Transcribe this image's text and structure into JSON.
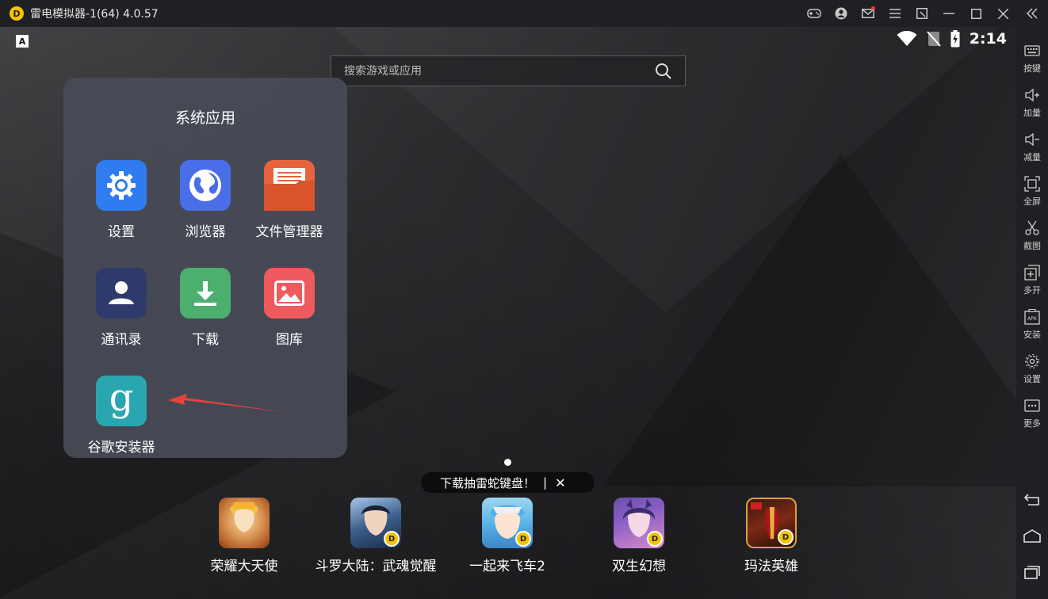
{
  "window": {
    "title": "雷电模拟器-1(64) 4.0.57",
    "logo_letter": "D"
  },
  "status_bar": {
    "input_indicator": "A",
    "time": "2:14"
  },
  "search": {
    "placeholder": "搜索游戏或应用"
  },
  "folder": {
    "title": "系统应用",
    "apps": [
      {
        "label": "设置",
        "icon": "gear-icon",
        "color": "#2f7cf0"
      },
      {
        "label": "浏览器",
        "icon": "globe-icon",
        "color": "#4a6ee8"
      },
      {
        "label": "文件管理器",
        "icon": "folder-file-icon",
        "color": "#e8643c"
      },
      {
        "label": "通讯录",
        "icon": "person-icon",
        "color": "#2d3a6b"
      },
      {
        "label": "下载",
        "icon": "download-icon",
        "color": "#4caf6e"
      },
      {
        "label": "图库",
        "icon": "image-icon",
        "color": "#ee5a5e"
      },
      {
        "label": "谷歌安装器",
        "icon": "google-installer-icon",
        "color": "#2aa6b0",
        "glyph": "g"
      }
    ]
  },
  "promo": {
    "text": "下载抽雷蛇键盘！",
    "separator": "|",
    "close": "✕"
  },
  "dock": [
    {
      "label": "荣耀大天使",
      "badge": false
    },
    {
      "label": "斗罗大陆：武魂觉醒",
      "badge": true
    },
    {
      "label": "一起来飞车2",
      "badge": true
    },
    {
      "label": "双生幻想",
      "badge": true
    },
    {
      "label": "玛法英雄",
      "badge": true
    }
  ],
  "dock_badge_letter": "D",
  "sidebar": {
    "items": [
      {
        "label": "按键",
        "icon": "keyboard-icon"
      },
      {
        "label": "加量",
        "icon": "volume-up-icon"
      },
      {
        "label": "减量",
        "icon": "volume-down-icon"
      },
      {
        "label": "全屏",
        "icon": "fullscreen-icon"
      },
      {
        "label": "截图",
        "icon": "scissors-icon"
      },
      {
        "label": "多开",
        "icon": "multi-instance-icon"
      },
      {
        "label": "安装",
        "icon": "apk-install-icon"
      },
      {
        "label": "设置",
        "icon": "settings-icon"
      },
      {
        "label": "更多",
        "icon": "more-icon"
      }
    ]
  },
  "colors": {
    "titlebar": "#1f2023",
    "folder_bg": "#484b56",
    "accent_yellow": "#f5c400",
    "arrow_red": "#e8423c"
  }
}
